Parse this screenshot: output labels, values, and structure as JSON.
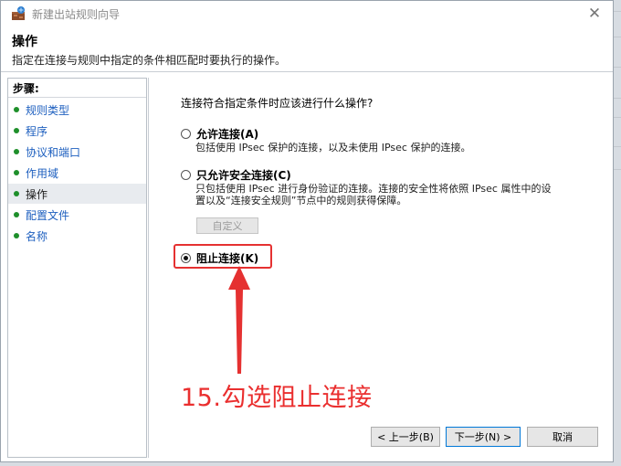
{
  "window": {
    "title": "新建出站规则向导",
    "close_glyph": "✕"
  },
  "header": {
    "title": "操作",
    "description": "指定在连接与规则中指定的条件相匹配时要执行的操作。"
  },
  "steps": {
    "label": "步骤:",
    "items": [
      {
        "label": "规则类型",
        "active": false
      },
      {
        "label": "程序",
        "active": false
      },
      {
        "label": "协议和端口",
        "active": false
      },
      {
        "label": "作用域",
        "active": false
      },
      {
        "label": "操作",
        "active": true
      },
      {
        "label": "配置文件",
        "active": false
      },
      {
        "label": "名称",
        "active": false
      }
    ]
  },
  "main": {
    "question": "连接符合指定条件时应该进行什么操作?",
    "options": [
      {
        "label": "允许连接(A)",
        "description_lines": [
          "包括使用 IPsec 保护的连接，以及未使用 IPsec 保护的连接。"
        ],
        "checked": false
      },
      {
        "label": "只允许安全连接(C)",
        "description_lines": [
          "只包括使用 IPsec 进行身份验证的连接。连接的安全性将依照 IPsec 属性中的设",
          "置以及“连接安全规则”节点中的规则获得保障。"
        ],
        "checked": false
      },
      {
        "label": "阻止连接(K)",
        "description_lines": [],
        "checked": true
      }
    ],
    "customize_label": "自定义",
    "annotation": "15.勾选阻止连接"
  },
  "buttons": {
    "back": "< 上一步(B)",
    "next": "下一步(N) >",
    "cancel": "取消"
  },
  "colors": {
    "annotation_red": "#ea2f2f",
    "link_blue": "#1d5fbf",
    "step_dot_green": "#1e8f2a",
    "primary_border": "#0078d7"
  }
}
